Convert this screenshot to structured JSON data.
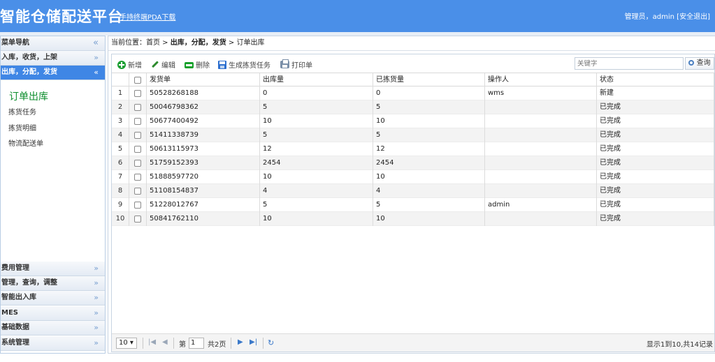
{
  "header": {
    "title": "智能仓储配送平台",
    "pda_link": "手持终端PDA下载",
    "user_info": "管理员，admin [安全退出]"
  },
  "sidebar": {
    "title": "菜单导航",
    "title_icon": "double-chevron-left-icon",
    "items": [
      {
        "label": "入库，收货，上架"
      },
      {
        "label": "出库，分配，发货",
        "active": true
      },
      {
        "label": "费用管理"
      },
      {
        "label": "管理，查询，调整"
      },
      {
        "label": "智能出入库"
      },
      {
        "label": "MES"
      },
      {
        "label": "基础数据"
      },
      {
        "label": "系统管理"
      }
    ],
    "submenu": {
      "heading": "订单出库",
      "items": [
        "拣货任务",
        "拣货明细",
        "物流配送单"
      ]
    }
  },
  "breadcrumb": {
    "prefix": "当前位置：",
    "home": "首页",
    "sep": " > ",
    "section": "出库，分配，发货",
    "page": "订单出库"
  },
  "toolbar": {
    "add": "新增",
    "edit": "编辑",
    "delete": "删除",
    "generate": "生成拣货任务",
    "print": "打印单",
    "search_placeholder": "关键字",
    "search_button": "查询"
  },
  "table": {
    "columns": [
      "发货单",
      "出库量",
      "已拣货量",
      "操作人",
      "状态"
    ],
    "rows": [
      {
        "n": "1",
        "order": "50528268188",
        "qty": "0",
        "picked": "0",
        "operator": "wms",
        "status": "新建"
      },
      {
        "n": "2",
        "order": "50046798362",
        "qty": "5",
        "picked": "5",
        "operator": "",
        "status": "已完成"
      },
      {
        "n": "3",
        "order": "50677400492",
        "qty": "10",
        "picked": "10",
        "operator": "",
        "status": "已完成"
      },
      {
        "n": "4",
        "order": "51411338739",
        "qty": "5",
        "picked": "5",
        "operator": "",
        "status": "已完成"
      },
      {
        "n": "5",
        "order": "50613115973",
        "qty": "12",
        "picked": "12",
        "operator": "",
        "status": "已完成"
      },
      {
        "n": "6",
        "order": "51759152393",
        "qty": "2454",
        "picked": "2454",
        "operator": "",
        "status": "已完成"
      },
      {
        "n": "7",
        "order": "51888597720",
        "qty": "10",
        "picked": "10",
        "operator": "",
        "status": "已完成"
      },
      {
        "n": "8",
        "order": "51108154837",
        "qty": "4",
        "picked": "4",
        "operator": "",
        "status": "已完成"
      },
      {
        "n": "9",
        "order": "51228012767",
        "qty": "5",
        "picked": "5",
        "operator": "admin",
        "status": "已完成"
      },
      {
        "n": "10",
        "order": "50841762110",
        "qty": "10",
        "picked": "10",
        "operator": "",
        "status": "已完成"
      }
    ]
  },
  "pager": {
    "page_size": "10 ▾",
    "page_prefix": "第",
    "page_value": "1",
    "page_total": "共2页",
    "summary": "显示1到10,共14记录"
  },
  "colors": {
    "header_bg": "#4a8fe8",
    "active_nav": "#3f86e5",
    "submenu_heading": "#0e8e2e"
  }
}
